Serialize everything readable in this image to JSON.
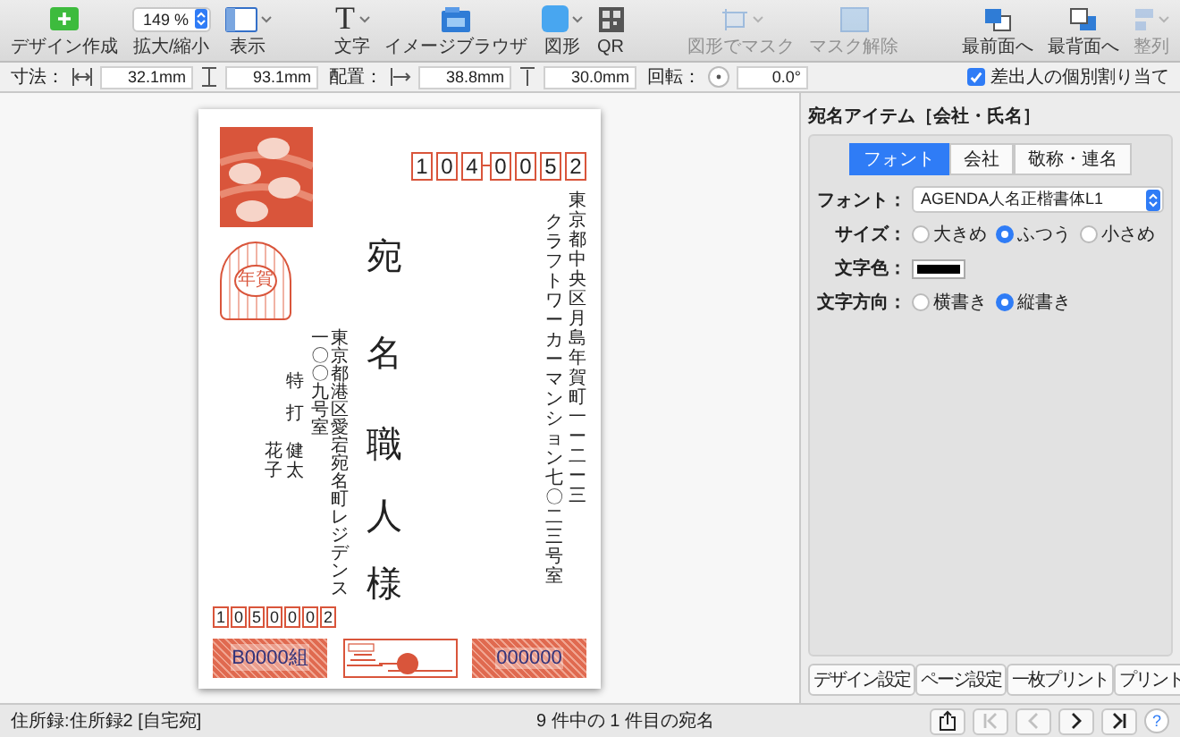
{
  "toolbar": {
    "groups": [
      [
        {
          "kind": "add",
          "label": "デザイン作成",
          "disabled": false
        },
        {
          "kind": "zoom",
          "label": "拡大/縮小",
          "value": "149 %",
          "disabled": false
        },
        {
          "kind": "view",
          "label": "表示",
          "disabled": false,
          "has_menu": true
        }
      ],
      [
        {
          "kind": "text",
          "glyph": "T",
          "label": "文字",
          "disabled": false,
          "has_menu": true
        },
        {
          "kind": "image",
          "label": "イメージブラウザ",
          "disabled": false
        },
        {
          "kind": "shape",
          "label": "図形",
          "disabled": false,
          "has_menu": true
        },
        {
          "kind": "qr",
          "label": "QR",
          "disabled": false
        }
      ],
      [
        {
          "kind": "mask",
          "label": "図形でマスク",
          "disabled": true,
          "has_menu": true
        },
        {
          "kind": "unmask",
          "label": "マスク解除",
          "disabled": true
        }
      ],
      [
        {
          "kind": "front",
          "label": "最前面へ",
          "disabled": false
        },
        {
          "kind": "back",
          "label": "最背面へ",
          "disabled": false
        },
        {
          "kind": "align",
          "label": "整列",
          "disabled": true,
          "has_menu": true
        }
      ]
    ]
  },
  "format_bar": {
    "groups": [
      {
        "label": "寸法：",
        "fields": [
          {
            "kind": "width",
            "value": "32.1mm"
          },
          {
            "kind": "height",
            "value": "93.1mm"
          }
        ]
      },
      {
        "label": "配置：",
        "fields": [
          {
            "kind": "x",
            "value": "38.8mm"
          },
          {
            "kind": "y",
            "value": "30.0mm"
          }
        ]
      },
      {
        "label": "回転：",
        "fields": [
          {
            "kind": "angle",
            "value": "0.0°"
          }
        ]
      }
    ],
    "sender_option": {
      "label": "差出人の個別割り当て",
      "checked": true
    }
  },
  "card": {
    "recipient": {
      "postal_code": [
        "1",
        "0",
        "4",
        "0",
        "0",
        "5",
        "2"
      ],
      "address_lines": [
        "クラフトワーカーマンション七〇二三号室",
        "東京都中央区月島年賀町一ー二ー三"
      ],
      "family_name": "宛名",
      "given_name": "職人",
      "honorific": "様"
    },
    "sender": {
      "address_lines": [
        "一〇〇九号室",
        "東京都港区愛宕宛名町レジデンス"
      ],
      "family_name": "特打",
      "given_names": [
        "花子",
        "健太"
      ],
      "postal_code": [
        "1",
        "0",
        "5",
        "0",
        "0",
        "0",
        "2"
      ]
    },
    "stamp_text": "年賀",
    "lottery": {
      "group": "B0000組",
      "number": "000000"
    }
  },
  "panel": {
    "title": "宛名アイテム［会社・氏名］",
    "tabs": [
      {
        "label": "フォント",
        "selected": true
      },
      {
        "label": "会社",
        "selected": false
      },
      {
        "label": "敬称・連名",
        "selected": false
      }
    ],
    "rows": [
      {
        "kind": "select",
        "label": "フォント：",
        "value": "AGENDA人名正楷書体L1"
      },
      {
        "kind": "radio",
        "label": "サイズ：",
        "options": [
          {
            "label": "大きめ",
            "selected": false
          },
          {
            "label": "ふつう",
            "selected": true
          },
          {
            "label": "小さめ",
            "selected": false
          }
        ]
      },
      {
        "kind": "color",
        "label": "文字色：",
        "color": "#000000"
      },
      {
        "kind": "radio",
        "label": "文字方向：",
        "options": [
          {
            "label": "横書き",
            "selected": false
          },
          {
            "label": "縦書き",
            "selected": true
          }
        ]
      }
    ],
    "buttons": [
      "デザイン設定",
      "ページ設定",
      "一枚プリント",
      "プリント"
    ]
  },
  "status_bar": {
    "address_book": "住所録:住所録2 [自宅宛]",
    "position": "9 件中の 1 件目の宛名",
    "nav": [
      {
        "kind": "share",
        "disabled": false
      },
      {
        "kind": "first",
        "disabled": true
      },
      {
        "kind": "prev",
        "disabled": true
      },
      {
        "kind": "next",
        "disabled": false
      },
      {
        "kind": "last",
        "disabled": false
      },
      {
        "kind": "help",
        "label": "?",
        "disabled": false
      }
    ]
  }
}
